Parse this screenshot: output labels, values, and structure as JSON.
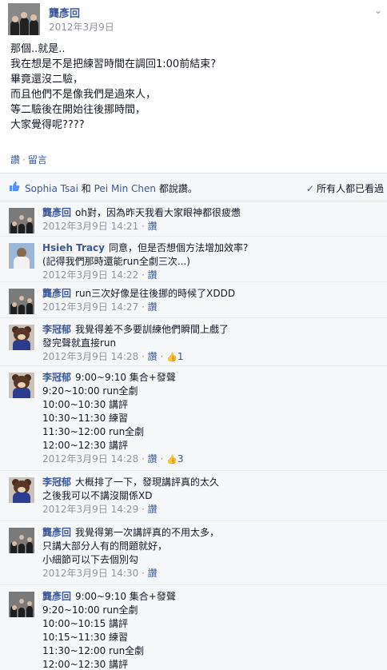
{
  "post": {
    "author": "龔彥回",
    "date": "2012年3月9日",
    "chevron": "⌄",
    "lines": [
      "那個..就是..",
      "我在想是不是把練習時間在調回1:00前結束?",
      "畢竟還沒二驗，",
      "而且他們不是像我們是過來人，",
      "等二驗後在開始往後挪時間，",
      "大家覺得呢????"
    ],
    "actions": {
      "like": "讚",
      "sep": "·",
      "comment": "留言"
    }
  },
  "likes": {
    "name1": "Sophia Tsai",
    "and": " 和 ",
    "name2": "Pei Min Chen",
    "suffix": " 都說讚。",
    "seen": "所有人都已看過"
  },
  "comments": [
    {
      "name": "龔彥回",
      "avatar": "group-photo",
      "lines": [
        "oh對，因為昨天我看大家眼神都很疲憊"
      ],
      "time": "2012年3月9日 14:21",
      "like_label": "讚",
      "like_count": ""
    },
    {
      "name": "Hsieh Tracy",
      "avatar": "tracy-photo",
      "lines": [
        "同意，但是否想個方法增加效率?",
        "(記得我們那時還能run全劇三次...)"
      ],
      "time": "2012年3月9日 14:22",
      "like_label": "讚",
      "like_count": ""
    },
    {
      "name": "龔彥回",
      "avatar": "group-photo",
      "lines": [
        "run三次好像是往後挪的時候了XDDD"
      ],
      "time": "2012年3月9日 14:27",
      "like_label": "讚",
      "like_count": ""
    },
    {
      "name": "李冠郁",
      "avatar": "bear-avatar",
      "lines": [
        "我覺得差不多要訓練他們瞬間上戲了",
        "發完聲就直接run"
      ],
      "time": "2012年3月9日 14:28",
      "like_label": "讚",
      "like_count": "1"
    },
    {
      "name": "李冠郁",
      "avatar": "bear-avatar",
      "lines": [
        "9:00~9:10 集合+發聲",
        "9:20~10:00 run全劇",
        "10:00~10:30 講評",
        "10:30~11:30 練習",
        "11:30~12:00 run全劇",
        "12:00~12:30 講評"
      ],
      "time": "2012年3月9日 14:28",
      "like_label": "讚",
      "like_count": "3"
    },
    {
      "name": "李冠郁",
      "avatar": "bear-avatar",
      "lines": [
        "大概排了一下，發現講評真的太久",
        "之後我可以不講沒關係XD"
      ],
      "time": "2012年3月9日 14:29",
      "like_label": "讚",
      "like_count": ""
    },
    {
      "name": "龔彥回",
      "avatar": "group-photo",
      "lines": [
        "我覺得第一次講評真的不用太多，",
        "只講大部分人有的問題就好，",
        "小細節可以下去個別勾"
      ],
      "time": "2012年3月9日 14:30",
      "like_label": "讚",
      "like_count": ""
    },
    {
      "name": "龔彥回",
      "avatar": "group-photo",
      "lines": [
        "9:00~9:10 集合+發聲",
        "9:20~10:00 run全劇",
        "10:00~10:15 講評",
        "10:15~11:30 練習",
        "11:30~12:00 run全劇",
        "12:00~12:30 講評"
      ],
      "time": "",
      "like_label": "",
      "like_count": ""
    }
  ],
  "colors": {
    "link": "#3b5998",
    "meta": "#90949c",
    "text": "#141823",
    "panel": "#f6f7f9"
  },
  "icons": {
    "like": "thumbs-up-icon",
    "seen": "check-icon",
    "chevron": "chevron-down-icon"
  }
}
